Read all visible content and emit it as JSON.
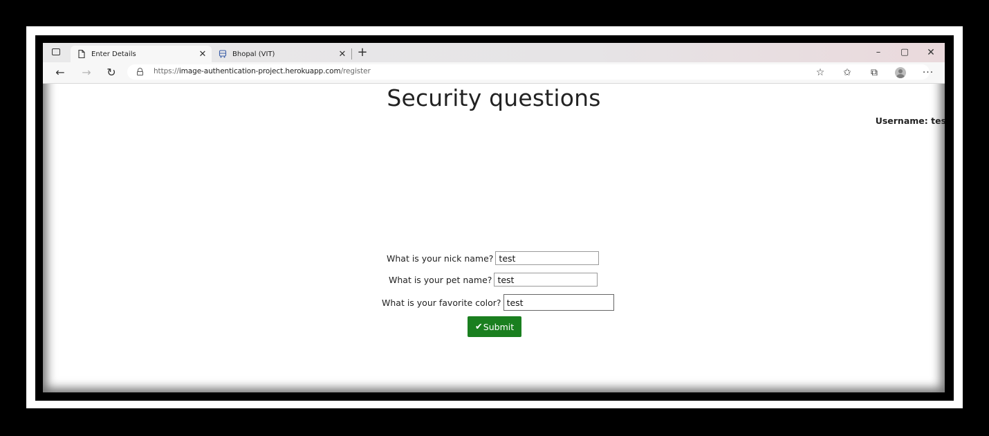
{
  "browser": {
    "tabs": [
      {
        "title": "Enter Details",
        "icon": "page-icon",
        "active": true
      },
      {
        "title": "Bhopal (VIT)",
        "icon": "bus-icon",
        "active": false
      }
    ],
    "new_tab_symbol": "+",
    "window_controls": {
      "minimize": "–",
      "maximize": "▢",
      "close": "✕"
    },
    "address": {
      "protocol": "https://",
      "host": "image-authentication-project.herokuapp.com",
      "path": "/register"
    }
  },
  "page": {
    "title": "Security questions",
    "username_label": "Username: test",
    "questions": [
      {
        "label": "What is your nick name?",
        "value": "test"
      },
      {
        "label": "What is your pet name?",
        "value": "test"
      },
      {
        "label": "What is your favorite color?",
        "value": "test"
      }
    ],
    "submit_label": "Submit",
    "submit_color": "#1a7f1f"
  }
}
